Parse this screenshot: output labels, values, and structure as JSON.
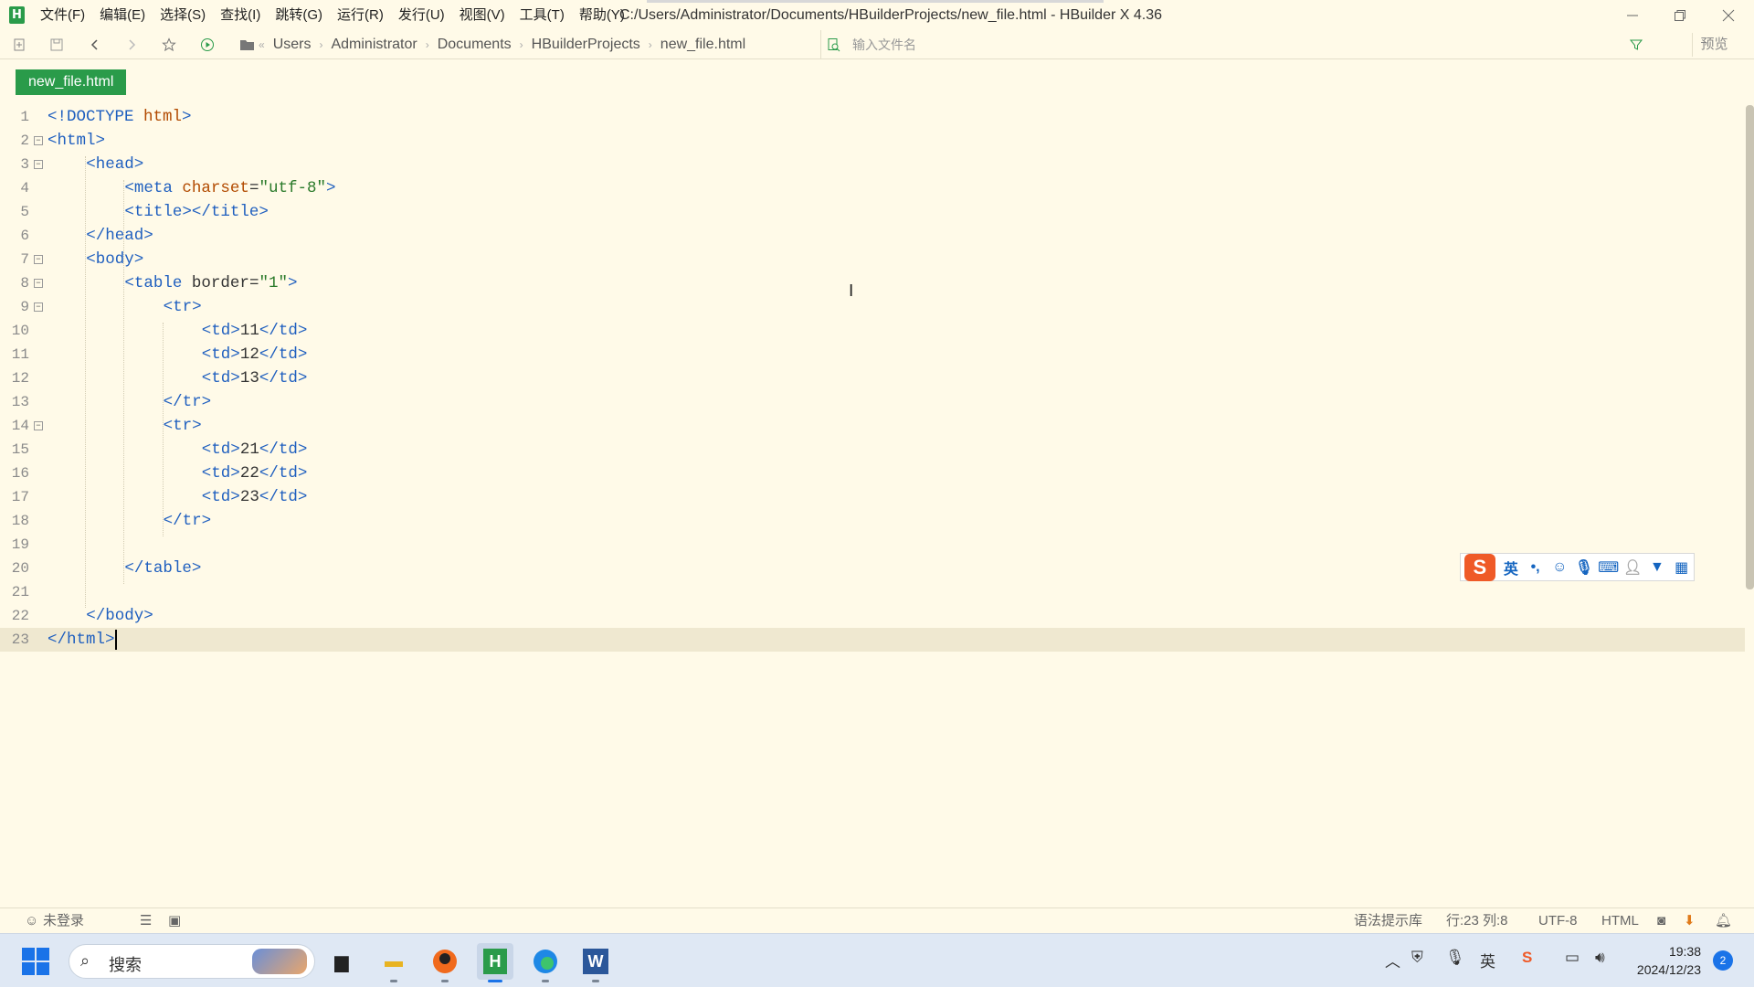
{
  "window": {
    "title": "C:/Users/Administrator/Documents/HBuilderProjects/new_file.html - HBuilder X 4.36",
    "app_icon": "H"
  },
  "menu": [
    "文件(F)",
    "编辑(E)",
    "选择(S)",
    "查找(I)",
    "跳转(G)",
    "运行(R)",
    "发行(U)",
    "视图(V)",
    "工具(T)",
    "帮助(Y)"
  ],
  "breadcrumb": [
    "Users",
    "Administrator",
    "Documents",
    "HBuilderProjects",
    "new_file.html"
  ],
  "file_search": {
    "placeholder": "输入文件名"
  },
  "toolbar": {
    "preview_label": "预览"
  },
  "tab": {
    "label": "new_file.html"
  },
  "editor": {
    "current_line": 23,
    "lines": [
      {
        "n": "1",
        "fold": false,
        "indent": 0,
        "html": "<span class=\"tag\">&lt;!DOCTYPE</span> <span class=\"attr\">html</span><span class=\"tag\">&gt;</span>"
      },
      {
        "n": "2",
        "fold": true,
        "indent": 0,
        "html": "<span class=\"tag\">&lt;html&gt;</span>"
      },
      {
        "n": "3",
        "fold": true,
        "indent": 1,
        "html": "<span class=\"tag\">&lt;head&gt;</span>"
      },
      {
        "n": "4",
        "fold": false,
        "indent": 2,
        "html": "<span class=\"tag\">&lt;meta</span> <span class=\"attr\">charset</span>=<span class=\"str\">\"utf-8\"</span><span class=\"tag\">&gt;</span>"
      },
      {
        "n": "5",
        "fold": false,
        "indent": 2,
        "html": "<span class=\"tag\">&lt;title&gt;&lt;/title&gt;</span>"
      },
      {
        "n": "6",
        "fold": false,
        "indent": 1,
        "html": "<span class=\"tag\">&lt;/head&gt;</span>"
      },
      {
        "n": "7",
        "fold": true,
        "indent": 1,
        "html": "<span class=\"tag\">&lt;body&gt;</span>"
      },
      {
        "n": "8",
        "fold": true,
        "indent": 2,
        "html": "<span class=\"tag\">&lt;table</span> <span class=\"txt\">border</span>=<span class=\"str\">\"1\"</span><span class=\"tag\">&gt;</span>"
      },
      {
        "n": "9",
        "fold": true,
        "indent": 3,
        "html": "<span class=\"tag\">&lt;tr&gt;</span>"
      },
      {
        "n": "10",
        "fold": false,
        "indent": 4,
        "html": "<span class=\"tag\">&lt;td&gt;</span><span class=\"txt\">11</span><span class=\"tag\">&lt;/td&gt;</span>"
      },
      {
        "n": "11",
        "fold": false,
        "indent": 4,
        "html": "<span class=\"tag\">&lt;td&gt;</span><span class=\"txt\">12</span><span class=\"tag\">&lt;/td&gt;</span>"
      },
      {
        "n": "12",
        "fold": false,
        "indent": 4,
        "html": "<span class=\"tag\">&lt;td&gt;</span><span class=\"txt\">13</span><span class=\"tag\">&lt;/td&gt;</span>"
      },
      {
        "n": "13",
        "fold": false,
        "indent": 3,
        "html": "<span class=\"tag\">&lt;/tr&gt;</span>"
      },
      {
        "n": "14",
        "fold": true,
        "indent": 3,
        "html": "<span class=\"tag\">&lt;tr&gt;</span>"
      },
      {
        "n": "15",
        "fold": false,
        "indent": 4,
        "html": "<span class=\"tag\">&lt;td&gt;</span><span class=\"txt\">21</span><span class=\"tag\">&lt;/td&gt;</span>"
      },
      {
        "n": "16",
        "fold": false,
        "indent": 4,
        "html": "<span class=\"tag\">&lt;td&gt;</span><span class=\"txt\">22</span><span class=\"tag\">&lt;/td&gt;</span>"
      },
      {
        "n": "17",
        "fold": false,
        "indent": 4,
        "html": "<span class=\"tag\">&lt;td&gt;</span><span class=\"txt\">23</span><span class=\"tag\">&lt;/td&gt;</span>"
      },
      {
        "n": "18",
        "fold": false,
        "indent": 3,
        "html": "<span class=\"tag\">&lt;/tr&gt;</span>"
      },
      {
        "n": "19",
        "fold": false,
        "indent": 0,
        "html": ""
      },
      {
        "n": "20",
        "fold": false,
        "indent": 2,
        "html": "<span class=\"tag\">&lt;/table&gt;</span>"
      },
      {
        "n": "21",
        "fold": false,
        "indent": 0,
        "html": ""
      },
      {
        "n": "22",
        "fold": false,
        "indent": 1,
        "html": "<span class=\"tag\">&lt;/body&gt;</span>"
      },
      {
        "n": "23",
        "fold": false,
        "indent": 0,
        "html": "<span class=\"tag\">&lt;/html&gt;</span>"
      }
    ]
  },
  "ime": {
    "logo": "S",
    "mode": "英",
    "icons": [
      "punctuation-icon",
      "emoji-icon",
      "microphone-icon",
      "keyboard-icon",
      "user-icon",
      "skin-icon",
      "grid-icon"
    ]
  },
  "statusbar": {
    "login": "未登录",
    "syntax_lib": "语法提示库",
    "position": "行:23  列:8",
    "encoding": "UTF-8",
    "language": "HTML"
  },
  "taskbar": {
    "search_label": "搜索",
    "apps": [
      "task-view",
      "file-explorer",
      "sogou-browser",
      "hbuilderx",
      "edge",
      "word"
    ],
    "tray": {
      "ime_label": "英",
      "time": "19:38",
      "date": "2024/12/23",
      "notifications": "2"
    }
  },
  "colors": {
    "accent": "#2a9b4a",
    "editor_bg": "#fffae8",
    "tag": "#1f5fbf",
    "attr": "#b24a00",
    "string": "#2a7a2a"
  }
}
